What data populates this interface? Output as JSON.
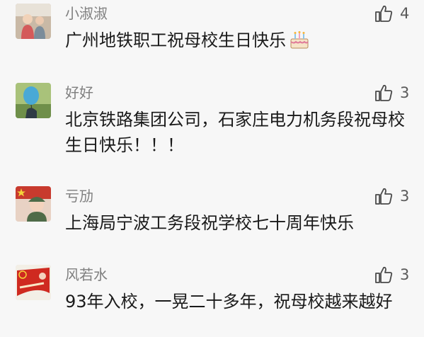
{
  "comments": [
    {
      "nickname": "小淑淑",
      "likes": "4",
      "text": "广州地铁职工祝母校生日快乐",
      "emoji": "cake-icon"
    },
    {
      "nickname": "好好",
      "likes": "3",
      "text": "北京铁路集团公司，石家庄电力机务段祝母校生日快乐！！！"
    },
    {
      "nickname": "亏劢",
      "likes": "3",
      "text": "上海局宁波工务段祝学校七十周年快乐"
    },
    {
      "nickname": "风若水",
      "likes": "3",
      "text": "93年入校，一晃二十多年，祝母校越来越好"
    }
  ],
  "colors": {
    "background": "#f7f7f7",
    "nickname": "#7f7f7f",
    "text": "#1a1a1a",
    "like_icon": "#4a4a4a"
  }
}
